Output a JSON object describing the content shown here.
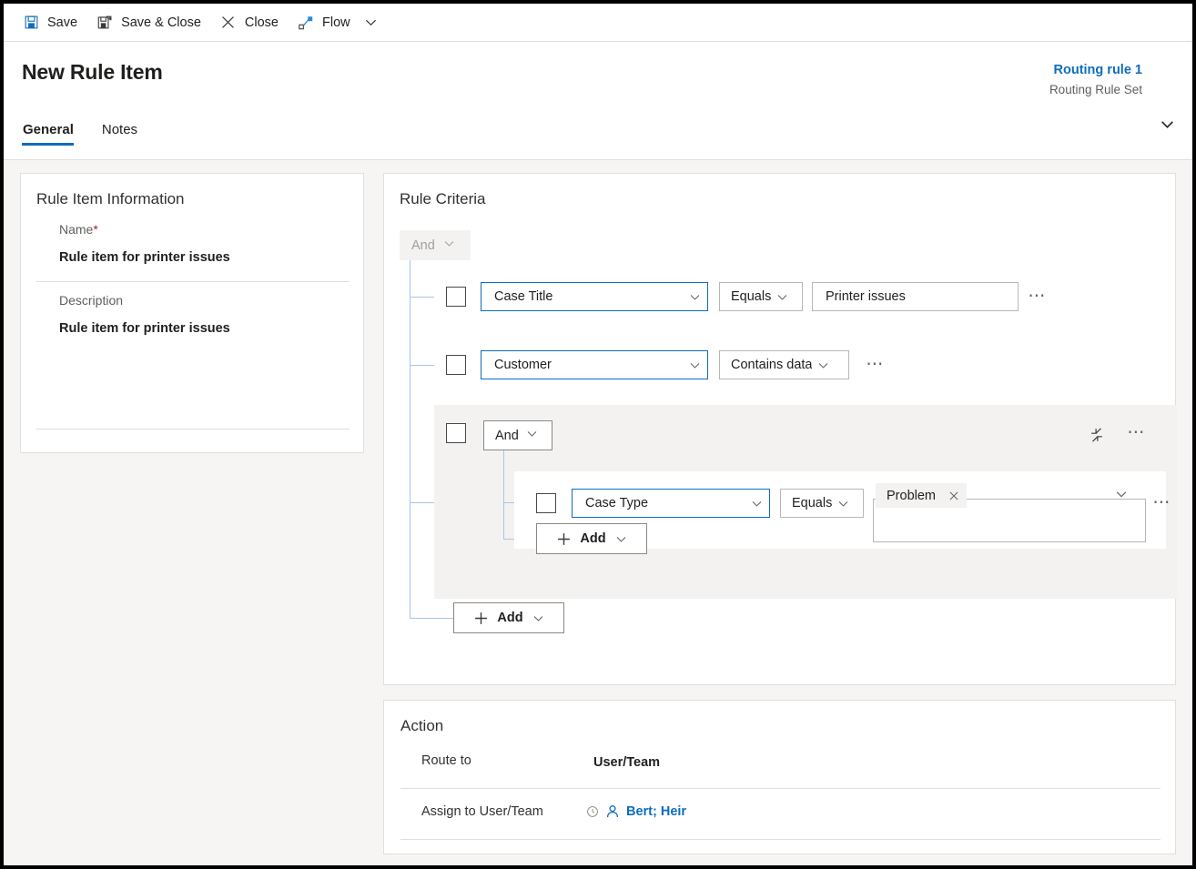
{
  "command_bar": {
    "buttons": [
      {
        "label": "Save",
        "icon": "save-icon"
      },
      {
        "label": "Save & Close",
        "icon": "save-and-close-icon"
      },
      {
        "label": "Close",
        "icon": "close-x-icon"
      },
      {
        "label": "Flow",
        "icon": "flow-icon"
      }
    ],
    "overflow_caret": "chevron-down-icon"
  },
  "header": {
    "title": "New Rule Item",
    "context_primary": "Routing rule 1",
    "context_secondary": "Routing Rule Set",
    "expand_caret": "chevron-down-icon",
    "tabs": [
      {
        "label": "General",
        "active": true
      },
      {
        "label": "Notes",
        "active": false
      }
    ]
  },
  "rule_item_information": {
    "title": "Rule Item Information",
    "name_label": "Name",
    "name_required_marker": "*",
    "name_value": "Rule item for printer issues",
    "description_label": "Description",
    "description_value": "Rule item for printer issues"
  },
  "rule_criteria": {
    "title": "Rule Criteria",
    "root_operator": "And",
    "rows": [
      {
        "attribute": "Case Title",
        "operator": "Equals",
        "value": "Printer issues",
        "more_label": "⋯"
      },
      {
        "attribute": "Customer",
        "operator": "Contains data",
        "more_label": "⋯"
      }
    ],
    "group": {
      "operator": "And",
      "collapse_icon": "collapse-arrows-icon",
      "more_label": "⋯",
      "row": {
        "attribute": "Case Type",
        "operator": "Equals",
        "value_chip": "Problem",
        "chip_remove_icon": "close-x-icon",
        "more_label": "⋯"
      },
      "add_label": "Add"
    },
    "add_label": "Add"
  },
  "action": {
    "title": "Action",
    "route_to_label": "Route to",
    "route_to_value": "User/Team",
    "assign_label": "Assign to User/Team",
    "assign_value": "Bert; Heir",
    "assign_status_icon": "recent-clock-icon",
    "assign_person_icon": "person-icon"
  },
  "colors": {
    "accent": "#0f6cbd",
    "required": "#a4262c",
    "tree_line": "#a9c5ea",
    "group_background": "#f3f2f1",
    "page_background": "#f6f5f4"
  }
}
